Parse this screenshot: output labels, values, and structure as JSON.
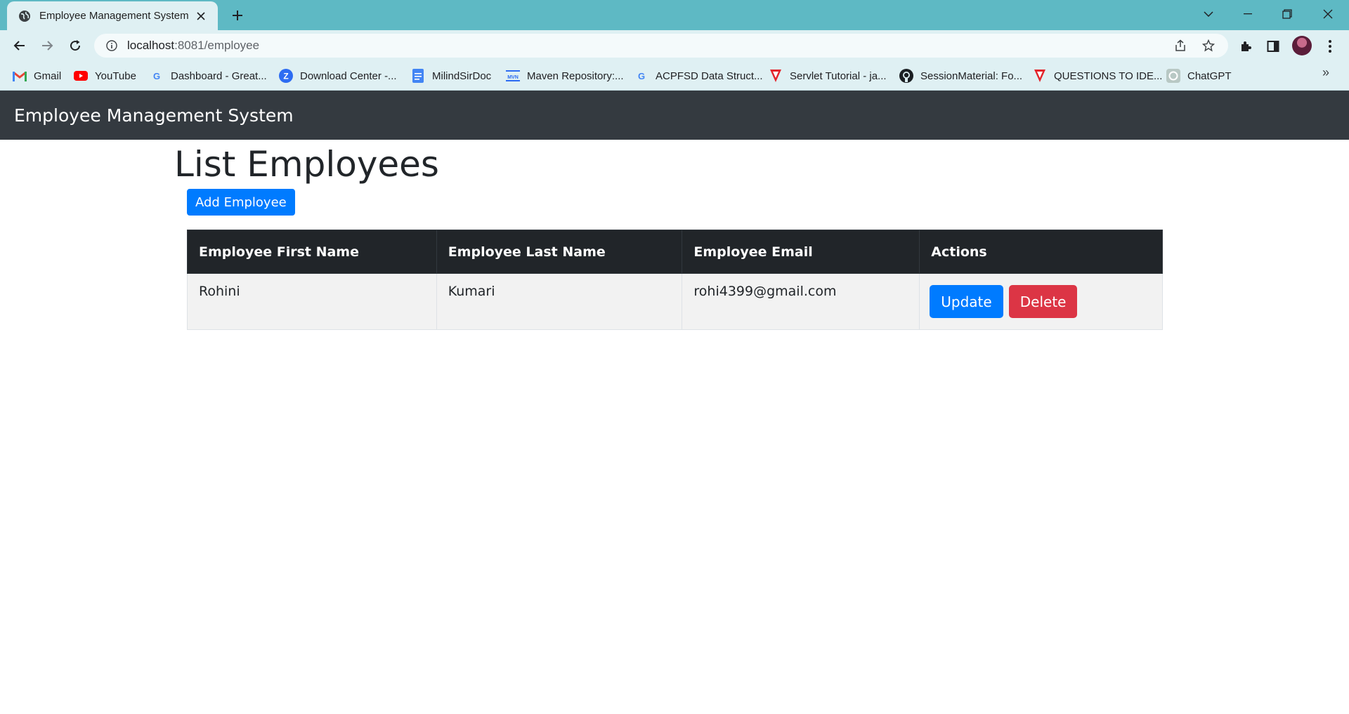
{
  "browser": {
    "tab_title": "Employee Management System",
    "url_host": "localhost",
    "url_rest": ":8081/employee",
    "bookmarks": [
      {
        "label": "Gmail",
        "icon": "gmail-icon"
      },
      {
        "label": "YouTube",
        "icon": "youtube-icon"
      },
      {
        "label": "Dashboard - Great...",
        "icon": "google-icon"
      },
      {
        "label": "Download Center -...",
        "icon": "zoom-icon"
      },
      {
        "label": "MilindSirDoc",
        "icon": "docs-icon"
      },
      {
        "label": "Maven Repository:...",
        "icon": "maven-icon"
      },
      {
        "label": "ACPFSD Data Struct...",
        "icon": "google-icon"
      },
      {
        "label": "Servlet Tutorial - ja...",
        "icon": "tpoint-icon"
      },
      {
        "label": "SessionMaterial: Fo...",
        "icon": "github-icon"
      },
      {
        "label": "QUESTIONS TO IDE...",
        "icon": "tpoint-icon"
      },
      {
        "label": "ChatGPT",
        "icon": "chatgpt-icon"
      }
    ],
    "more_bookmarks": "»"
  },
  "navbar": {
    "brand": "Employee Management System"
  },
  "page": {
    "heading": "List Employees",
    "add_button": "Add Employee"
  },
  "table": {
    "headers": [
      "Employee First Name",
      "Employee Last Name",
      "Employee Email",
      "Actions"
    ],
    "rows": [
      {
        "first_name": "Rohini",
        "last_name": "Kumari",
        "email": "rohi4399@gmail.com",
        "update_label": "Update",
        "delete_label": "Delete"
      }
    ]
  },
  "colors": {
    "navbar_bg": "#343a40",
    "primary": "#007bff",
    "danger": "#dc3545",
    "table_header_bg": "#212529",
    "browser_frame": "#5eb9c4"
  }
}
